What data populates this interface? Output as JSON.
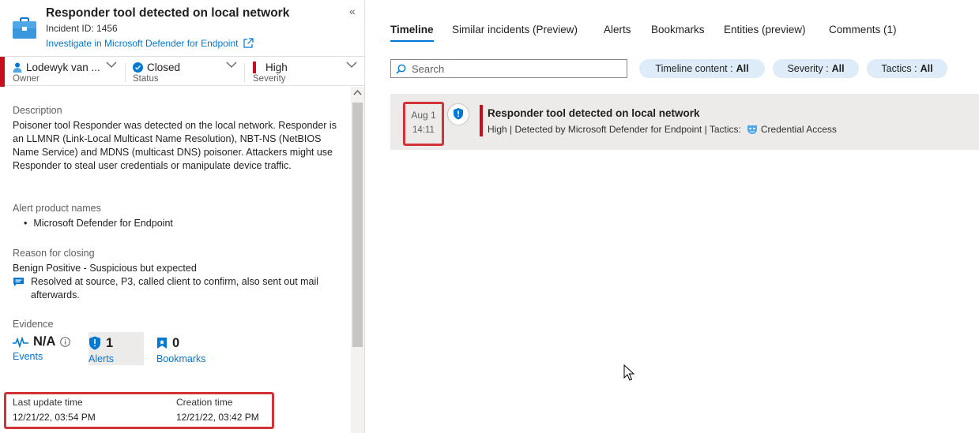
{
  "incident": {
    "title": "Responder tool detected on local network",
    "id_label": "Incident ID: 1456",
    "investigate_link": "Investigate in Microsoft Defender for Endpoint"
  },
  "properties": {
    "owner": {
      "value": "Lodewyk van ...",
      "label": "Owner"
    },
    "status": {
      "value": "Closed",
      "label": "Status"
    },
    "severity": {
      "value": "High",
      "label": "Severity"
    }
  },
  "details": {
    "description_label": "Description",
    "description": "Poisoner tool Responder was detected on the local network. Responder is an LLMNR (Link-Local Multicast Name Resolution), NBT-NS (NetBIOS Name Service) and MDNS (multicast DNS) poisoner. Attackers might use Responder to steal user credentials or manipulate device traffic.",
    "alert_products_label": "Alert product names",
    "alert_products": [
      "Microsoft Defender for Endpoint"
    ],
    "reason_label": "Reason for closing",
    "reason": "Benign Positive - Suspicious but expected",
    "closing_comment": "Resolved at source, P3, called client to confirm, also sent out mail afterwards.",
    "evidence_label": "Evidence",
    "evidence": {
      "events": {
        "value": "N/A",
        "label": "Events"
      },
      "alerts": {
        "value": "1",
        "label": "Alerts"
      },
      "bookmarks": {
        "value": "0",
        "label": "Bookmarks"
      }
    },
    "last_update_label": "Last update time",
    "last_update_value": "12/21/22, 03:54 PM",
    "creation_label": "Creation time",
    "creation_value": "12/21/22, 03:42 PM"
  },
  "tabs": [
    {
      "label": "Timeline",
      "active": true
    },
    {
      "label": "Similar incidents (Preview)",
      "active": false
    },
    {
      "label": "Alerts",
      "active": false
    },
    {
      "label": "Bookmarks",
      "active": false
    },
    {
      "label": "Entities (preview)",
      "active": false
    },
    {
      "label": "Comments (1)",
      "active": false
    }
  ],
  "search": {
    "placeholder": "Search"
  },
  "filters": [
    {
      "label": "Timeline content :",
      "value": "All"
    },
    {
      "label": "Severity :",
      "value": "All"
    },
    {
      "label": "Tactics :",
      "value": "All"
    }
  ],
  "timeline": [
    {
      "date": "Aug 1",
      "time": "14:11",
      "title": "Responder tool detected on local network",
      "subtitle": "High | Detected by Microsoft Defender for Endpoint | Tactics:",
      "tactic": "Credential Access"
    }
  ],
  "colors": {
    "accent": "#0078d4",
    "severity_high": "#c50f1f",
    "highlight_box": "#d13438",
    "pill_bg": "#deecf9",
    "row_bg": "#edebe9"
  },
  "icons": [
    "briefcase-icon",
    "external-link-icon",
    "collapse-icon",
    "person-icon",
    "check-circle-icon",
    "chevron-down-icon",
    "pulse-icon",
    "info-icon",
    "shield-alert-icon",
    "bookmark-icon",
    "comment-icon",
    "search-icon",
    "mask-icon",
    "pointer-cursor"
  ]
}
